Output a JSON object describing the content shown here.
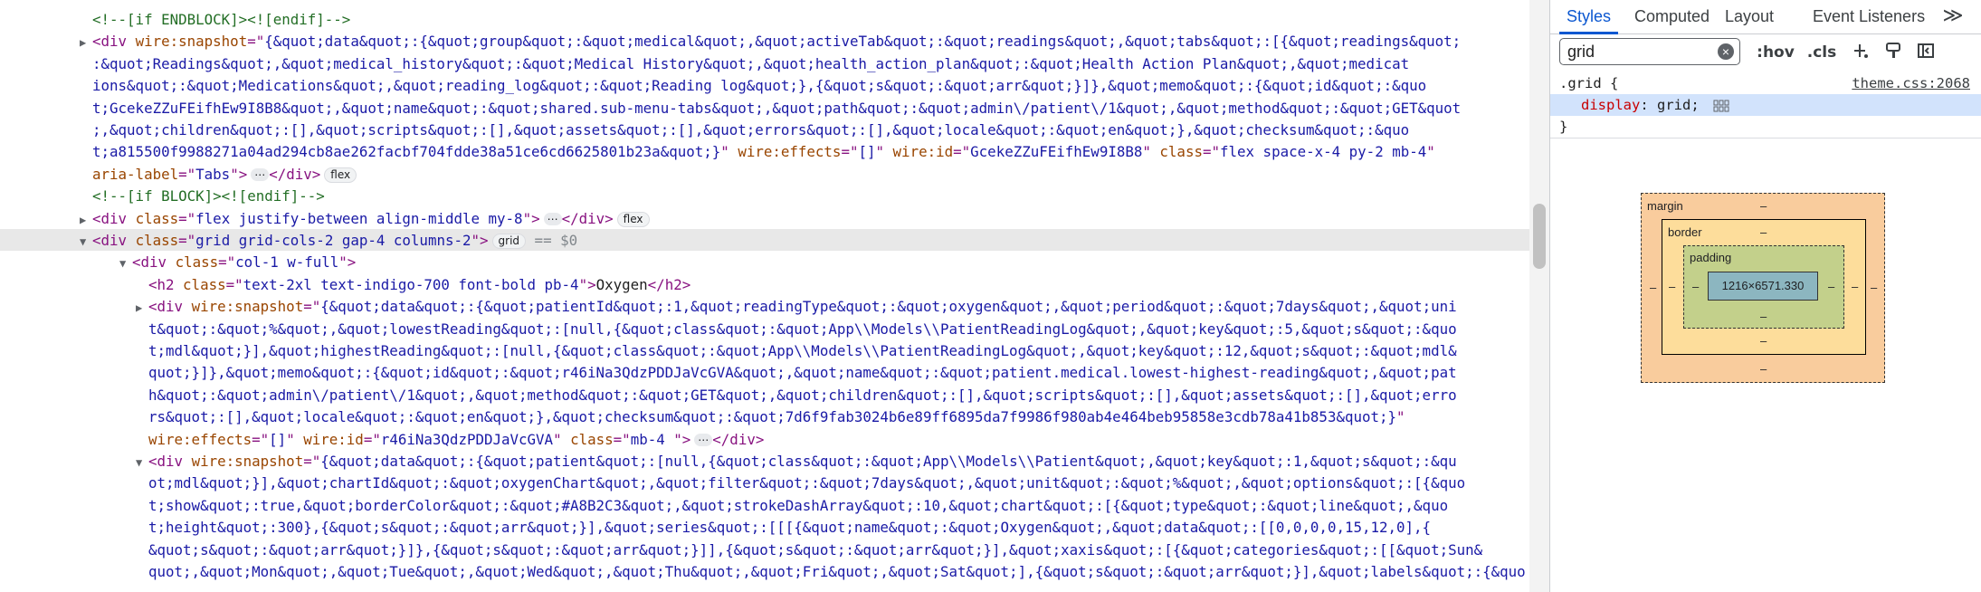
{
  "elements_panel": {
    "lines": [
      {
        "parts": [
          {
            "c": "cm",
            "t": "<!--[if ENDBLOCK]><![endif]-->"
          }
        ]
      },
      {
        "tri": "▶",
        "parts": [
          {
            "c": "tag",
            "t": "<div "
          },
          {
            "c": "an",
            "t": "wire:snapshot"
          },
          {
            "c": "tag",
            "t": "=\""
          },
          {
            "c": "av",
            "t": "{&quot;data&quot;:{&quot;group&quot;:&quot;medical&quot;,&quot;activeTab&quot;:&quot;readings&quot;,&quot;tabs&quot;:[{&quot;readings&quot;"
          }
        ]
      },
      {
        "parts": [
          {
            "c": "av",
            "t": ":&quot;Readings&quot;,&quot;medical_history&quot;:&quot;Medical History&quot;,&quot;health_action_plan&quot;:&quot;Health Action Plan&quot;,&quot;medicat"
          }
        ]
      },
      {
        "parts": [
          {
            "c": "av",
            "t": "ions&quot;:&quot;Medications&quot;,&quot;reading_log&quot;:&quot;Reading log&quot;},{&quot;s&quot;:&quot;arr&quot;}]},&quot;memo&quot;:{&quot;id&quot;:&quo"
          }
        ]
      },
      {
        "parts": [
          {
            "c": "av",
            "t": "t;GcekeZZuFEifhEw9I8B8&quot;,&quot;name&quot;:&quot;shared.sub-menu-tabs&quot;,&quot;path&quot;:&quot;admin\\/patient\\/1&quot;,&quot;method&quot;:&quot;GET&quot"
          }
        ]
      },
      {
        "parts": [
          {
            "c": "av",
            "t": ";,&quot;children&quot;:[],&quot;scripts&quot;:[],&quot;assets&quot;:[],&quot;errors&quot;:[],&quot;locale&quot;:&quot;en&quot;},&quot;checksum&quot;:&quo"
          }
        ]
      },
      {
        "parts": [
          {
            "c": "av",
            "t": "t;a815500f9988271a04ad294cb8ae262facbf704fdde38a51ce6cd6625801b23a&quot;}"
          },
          {
            "c": "tag",
            "t": "\" "
          },
          {
            "c": "an",
            "t": "wire:effects"
          },
          {
            "c": "tag",
            "t": "=\""
          },
          {
            "c": "av",
            "t": "[]"
          },
          {
            "c": "tag",
            "t": "\" "
          },
          {
            "c": "an",
            "t": "wire:id"
          },
          {
            "c": "tag",
            "t": "=\""
          },
          {
            "c": "av",
            "t": "GcekeZZuFEifhEw9I8B8"
          },
          {
            "c": "tag",
            "t": "\" "
          },
          {
            "c": "an",
            "t": "class"
          },
          {
            "c": "tag",
            "t": "=\""
          },
          {
            "c": "av",
            "t": "flex space-x-4 py-2 mb-4"
          },
          {
            "c": "tag",
            "t": "\""
          }
        ]
      },
      {
        "parts": [
          {
            "c": "an",
            "t": "aria-label"
          },
          {
            "c": "tag",
            "t": "=\""
          },
          {
            "c": "av",
            "t": "Tabs"
          },
          {
            "c": "tag",
            "t": "\">"
          },
          {
            "c": "ell",
            "t": "⋯"
          },
          {
            "c": "tag",
            "t": "</div>"
          },
          {
            "c": "badge",
            "t": "flex"
          }
        ]
      },
      {
        "parts": [
          {
            "c": "cm",
            "t": "<!--[if BLOCK]><![endif]-->"
          }
        ]
      },
      {
        "tri": "▶",
        "parts": [
          {
            "c": "tag",
            "t": "<div "
          },
          {
            "c": "an",
            "t": "class"
          },
          {
            "c": "tag",
            "t": "=\""
          },
          {
            "c": "av",
            "t": "flex justify-between align-middle my-8"
          },
          {
            "c": "tag",
            "t": "\">"
          },
          {
            "c": "ell",
            "t": "⋯"
          },
          {
            "c": "tag",
            "t": "</div>"
          },
          {
            "c": "badge",
            "t": "flex"
          }
        ]
      },
      {
        "tri": "▼",
        "selected": true,
        "parts": [
          {
            "c": "tag",
            "t": "<div "
          },
          {
            "c": "an",
            "t": "class"
          },
          {
            "c": "tag",
            "t": "=\""
          },
          {
            "c": "av",
            "t": "grid grid-cols-2 gap-4 columns-2"
          },
          {
            "c": "tag",
            "t": "\">"
          },
          {
            "c": "badge",
            "t": "grid"
          },
          {
            "c": "dim",
            "t": " == $0"
          }
        ]
      },
      {
        "tri": "▼",
        "indent": 1,
        "parts": [
          {
            "c": "tag",
            "t": "<div "
          },
          {
            "c": "an",
            "t": "class"
          },
          {
            "c": "tag",
            "t": "=\""
          },
          {
            "c": "av",
            "t": "col-1 w-full"
          },
          {
            "c": "tag",
            "t": "\">"
          }
        ]
      },
      {
        "indent": 2,
        "parts": [
          {
            "c": "tag",
            "t": "<h2 "
          },
          {
            "c": "an",
            "t": "class"
          },
          {
            "c": "tag",
            "t": "=\""
          },
          {
            "c": "av",
            "t": "text-2xl text-indigo-700 font-bold pb-4"
          },
          {
            "c": "tag",
            "t": "\">"
          },
          {
            "c": "tx",
            "t": "Oxygen"
          },
          {
            "c": "tag",
            "t": "</h2>"
          }
        ]
      },
      {
        "tri": "▶",
        "indent": 2,
        "parts": [
          {
            "c": "tag",
            "t": "<div "
          },
          {
            "c": "an",
            "t": "wire:snapshot"
          },
          {
            "c": "tag",
            "t": "=\""
          },
          {
            "c": "av",
            "t": "{&quot;data&quot;:{&quot;patientId&quot;:1,&quot;readingType&quot;:&quot;oxygen&quot;,&quot;period&quot;:&quot;7days&quot;,&quot;uni"
          }
        ]
      },
      {
        "indent": 2,
        "parts": [
          {
            "c": "av",
            "t": "t&quot;:&quot;%&quot;,&quot;lowestReading&quot;:[null,{&quot;class&quot;:&quot;App\\\\Models\\\\PatientReadingLog&quot;,&quot;key&quot;:5,&quot;s&quot;:&quo"
          }
        ]
      },
      {
        "indent": 2,
        "parts": [
          {
            "c": "av",
            "t": "t;mdl&quot;}],&quot;highestReading&quot;:[null,{&quot;class&quot;:&quot;App\\\\Models\\\\PatientReadingLog&quot;,&quot;key&quot;:12,&quot;s&quot;:&quot;mdl&"
          }
        ]
      },
      {
        "indent": 2,
        "parts": [
          {
            "c": "av",
            "t": "quot;}]},&quot;memo&quot;:{&quot;id&quot;:&quot;r46iNa3QdzPDDJaVcGVA&quot;,&quot;name&quot;:&quot;patient.medical.lowest-highest-reading&quot;,&quot;pat"
          }
        ]
      },
      {
        "indent": 2,
        "parts": [
          {
            "c": "av",
            "t": "h&quot;:&quot;admin\\/patient\\/1&quot;,&quot;method&quot;:&quot;GET&quot;,&quot;children&quot;:[],&quot;scripts&quot;:[],&quot;assets&quot;:[],&quot;erro"
          }
        ]
      },
      {
        "indent": 2,
        "parts": [
          {
            "c": "av",
            "t": "rs&quot;:[],&quot;locale&quot;:&quot;en&quot;},&quot;checksum&quot;:&quot;7d6f9fab3024b6e89ff6895da7f9986f980ab4e464beb95858e3cdb78a41b853&quot;}"
          },
          {
            "c": "tag",
            "t": "\""
          }
        ]
      },
      {
        "indent": 2,
        "parts": [
          {
            "c": "an",
            "t": "wire:effects"
          },
          {
            "c": "tag",
            "t": "=\""
          },
          {
            "c": "av",
            "t": "[]"
          },
          {
            "c": "tag",
            "t": "\" "
          },
          {
            "c": "an",
            "t": "wire:id"
          },
          {
            "c": "tag",
            "t": "=\""
          },
          {
            "c": "av",
            "t": "r46iNa3QdzPDDJaVcGVA"
          },
          {
            "c": "tag",
            "t": "\" "
          },
          {
            "c": "an",
            "t": "class"
          },
          {
            "c": "tag",
            "t": "=\""
          },
          {
            "c": "av",
            "t": "mb-4 "
          },
          {
            "c": "tag",
            "t": "\">"
          },
          {
            "c": "ell",
            "t": "⋯"
          },
          {
            "c": "tag",
            "t": "</div>"
          }
        ]
      },
      {
        "tri": "▼",
        "indent": 2,
        "parts": [
          {
            "c": "tag",
            "t": "<div "
          },
          {
            "c": "an",
            "t": "wire:snapshot"
          },
          {
            "c": "tag",
            "t": "=\""
          },
          {
            "c": "av",
            "t": "{&quot;data&quot;:{&quot;patient&quot;:[null,{&quot;class&quot;:&quot;App\\\\Models\\\\Patient&quot;,&quot;key&quot;:1,&quot;s&quot;:&qu"
          }
        ]
      },
      {
        "indent": 2,
        "parts": [
          {
            "c": "av",
            "t": "ot;mdl&quot;}],&quot;chartId&quot;:&quot;oxygenChart&quot;,&quot;filter&quot;:&quot;7days&quot;,&quot;unit&quot;:&quot;%&quot;,&quot;options&quot;:[{&quo"
          }
        ]
      },
      {
        "indent": 2,
        "parts": [
          {
            "c": "av",
            "t": "t;show&quot;:true,&quot;borderColor&quot;:&quot;#A8B2C3&quot;,&quot;strokeDashArray&quot;:10,&quot;chart&quot;:[{&quot;type&quot;:&quot;line&quot;,&quo"
          }
        ]
      },
      {
        "indent": 2,
        "parts": [
          {
            "c": "av",
            "t": "t;height&quot;:300},{&quot;s&quot;:&quot;arr&quot;}],&quot;series&quot;:[[[{&quot;name&quot;:&quot;Oxygen&quot;,&quot;data&quot;:[[0,0,0,0,15,12,0],{"
          }
        ]
      },
      {
        "indent": 2,
        "parts": [
          {
            "c": "av",
            "t": "&quot;s&quot;:&quot;arr&quot;}]},{&quot;s&quot;:&quot;arr&quot;}]],{&quot;s&quot;:&quot;arr&quot;}],&quot;xaxis&quot;:[{&quot;categories&quot;:[[&quot;Sun&"
          }
        ]
      },
      {
        "indent": 2,
        "parts": [
          {
            "c": "av",
            "t": "quot;,&quot;Mon&quot;,&quot;Tue&quot;,&quot;Wed&quot;,&quot;Thu&quot;,&quot;Fri&quot;,&quot;Sat&quot;],{&quot;s&quot;:&quot;arr&quot;}],&quot;labels&quot;:{&quo"
          }
        ]
      }
    ]
  },
  "sidebar": {
    "tabs": [
      "Styles",
      "Computed",
      "Layout",
      "Event Listeners"
    ],
    "active_tab": "Styles",
    "more": "≫",
    "filter_value": "grid",
    "hov_label": ":hov",
    "cls_label": ".cls",
    "rule": {
      "selector": ".grid {",
      "source": "theme.css:2068",
      "property": "display",
      "value": "grid",
      "close": "}"
    },
    "box_model": {
      "margin_label": "margin",
      "border_label": "border",
      "padding_label": "padding",
      "content_size": "1216×6571.330",
      "dash": "–"
    }
  }
}
